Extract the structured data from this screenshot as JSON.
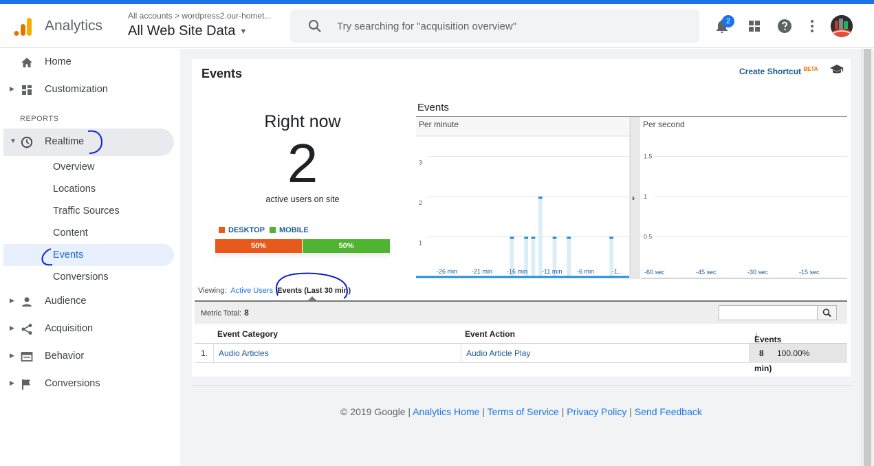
{
  "header": {
    "brand": "Analytics",
    "breadcrumb": "All accounts > wordpress2.our-homet...",
    "property": "All Web Site Data",
    "search_placeholder": "Try searching for \"acquisition overview\"",
    "notifications_count": "2"
  },
  "sidebar": {
    "home": "Home",
    "customization": "Customization",
    "reports_label": "REPORTS",
    "realtime": "Realtime",
    "realtime_items": [
      "Overview",
      "Locations",
      "Traffic Sources",
      "Content",
      "Events",
      "Conversions"
    ],
    "audience": "Audience",
    "acquisition": "Acquisition",
    "behavior": "Behavior",
    "conversions": "Conversions"
  },
  "page": {
    "title": "Events",
    "create_shortcut": "Create Shortcut",
    "beta": "BETA"
  },
  "rightnow": {
    "label": "Right now",
    "count": "2",
    "caption": "active users on site",
    "desktop_label": "DESKTOP",
    "mobile_label": "MOBILE",
    "desktop_pct": "50%",
    "mobile_pct": "50%",
    "desktop_share": 0.5,
    "mobile_share": 0.5,
    "desktop_color": "#e8591c",
    "mobile_color": "#50b432"
  },
  "chart_data": {
    "type": "bar",
    "title": "Events",
    "panels": [
      {
        "name": "Per minute",
        "y_ticks": [
          "1",
          "2",
          "3"
        ],
        "ylim": [
          0,
          3.3
        ],
        "x_tick_labels": [
          "-26 min",
          "-21 min",
          "-16 min",
          "-11 min",
          "-6 min",
          "-1..."
        ],
        "x": [
          -30,
          -29,
          -28,
          -27,
          -26,
          -25,
          -24,
          -23,
          -22,
          -21,
          -20,
          -19,
          -18,
          -17,
          -16,
          -15,
          -14,
          -13,
          -12,
          -11,
          -10,
          -9,
          -8,
          -7,
          -6,
          -5,
          -4,
          -3,
          -2,
          -1
        ],
        "values": [
          0,
          0,
          0,
          0,
          0,
          0,
          0,
          0,
          0,
          0,
          0,
          0,
          0,
          1,
          0,
          1,
          1,
          2,
          0,
          1,
          0,
          1,
          0,
          0,
          0,
          0,
          0,
          1,
          0,
          0
        ]
      },
      {
        "name": "Per second",
        "y_ticks": [
          "0.5",
          "1",
          "1.5"
        ],
        "ylim": [
          0,
          1.65
        ],
        "x_tick_labels": [
          "-60 sec",
          "-45 sec",
          "-30 sec",
          "-15 sec"
        ],
        "values": []
      }
    ]
  },
  "table": {
    "viewing_label": "Viewing:",
    "tab_active_users": "Active Users",
    "tab_events": "Events (Last 30 min)",
    "metric_total_label": "Metric Total:",
    "metric_total_value": "8",
    "columns": [
      "Event Category",
      "Event Action",
      "Events (Last 30 min)"
    ],
    "rows": [
      {
        "index": "1.",
        "category": "Audio Articles",
        "action": "Audio Article Play",
        "events": "8",
        "percent": "100.00%"
      }
    ]
  },
  "footer": {
    "copyright": "© 2019 Google",
    "links": [
      "Analytics Home",
      "Terms of Service",
      "Privacy Policy",
      "Send Feedback"
    ]
  },
  "colors": {
    "accent": "#1a73e8",
    "bar_fill": "#dbeef7",
    "bar_cap": "#1f8dd6"
  }
}
